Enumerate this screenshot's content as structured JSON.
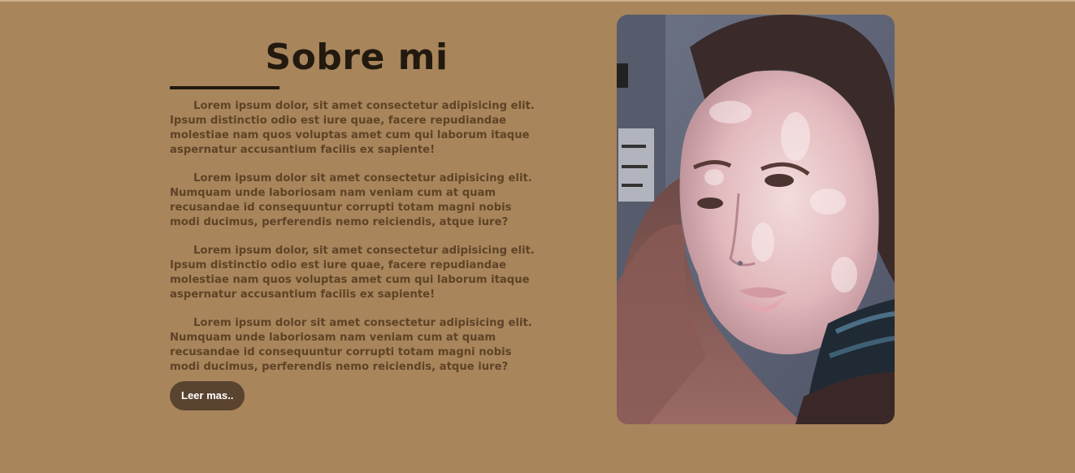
{
  "about": {
    "title": "Sobre mi",
    "paragraphs": [
      "Lorem ipsum dolor, sit amet consectetur adipisicing elit. Ipsum distinctio odio est iure quae, facere repudiandae molestiae nam quos voluptas amet cum qui laborum itaque aspernatur accusantium facilis ex sapiente!",
      "Lorem ipsum dolor sit amet consectetur adipisicing elit. Numquam unde laboriosam nam veniam cum at quam recusandae id consequuntur corrupti totam magni nobis modi ducimus, perferendis nemo reiciendis, atque iure?",
      "Lorem ipsum dolor, sit amet consectetur adipisicing elit. Ipsum distinctio odio est iure quae, facere repudiandae molestiae nam quos voluptas amet cum qui laborum itaque aspernatur accusantium facilis ex sapiente!",
      "Lorem ipsum dolor sit amet consectetur adipisicing elit. Numquam unde laboriosam nam veniam cum at quam recusandae id consequuntur corrupti totam magni nobis modi ducimus, perferendis nemo reiciendis, atque iure?"
    ],
    "button_label": "Leer mas.."
  },
  "colors": {
    "background": "#a8855b",
    "title": "#22190f",
    "body_text": "#5f4327",
    "button_bg": "#5a4430",
    "button_text": "#ffffff"
  }
}
